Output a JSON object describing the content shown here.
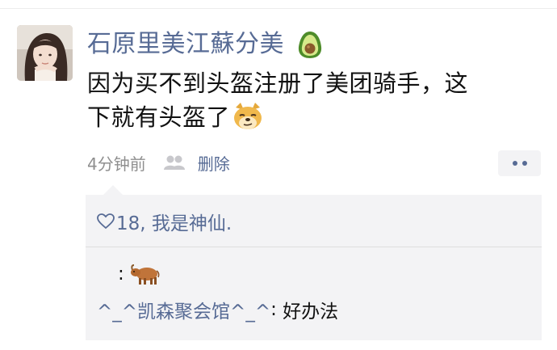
{
  "post": {
    "nickname": "石原里美江蘇分美",
    "badge_icon": "avocado-icon",
    "text_line1": "因为买不到头盔注册了美团骑手，这",
    "text_line2": "下就有头盔了",
    "text_emoji": "doge-icon"
  },
  "meta": {
    "time": "4分钟前",
    "visibility_icon": "friends-visibility-icon",
    "delete_label": "删除",
    "more_icon": "more-dots-icon"
  },
  "interactions": {
    "likes_text": "18, 我是神仙.",
    "comments": [
      {
        "author": "",
        "separator": ":",
        "text": "",
        "emoji": "ox-icon"
      },
      {
        "author": "^_^凯森聚会馆^_^",
        "separator": ":",
        "text": " 好办法"
      }
    ]
  },
  "colors": {
    "link_blue": "#576b95",
    "comment_bg": "#f3f3f5",
    "meta_gray": "#8f8f8f"
  }
}
